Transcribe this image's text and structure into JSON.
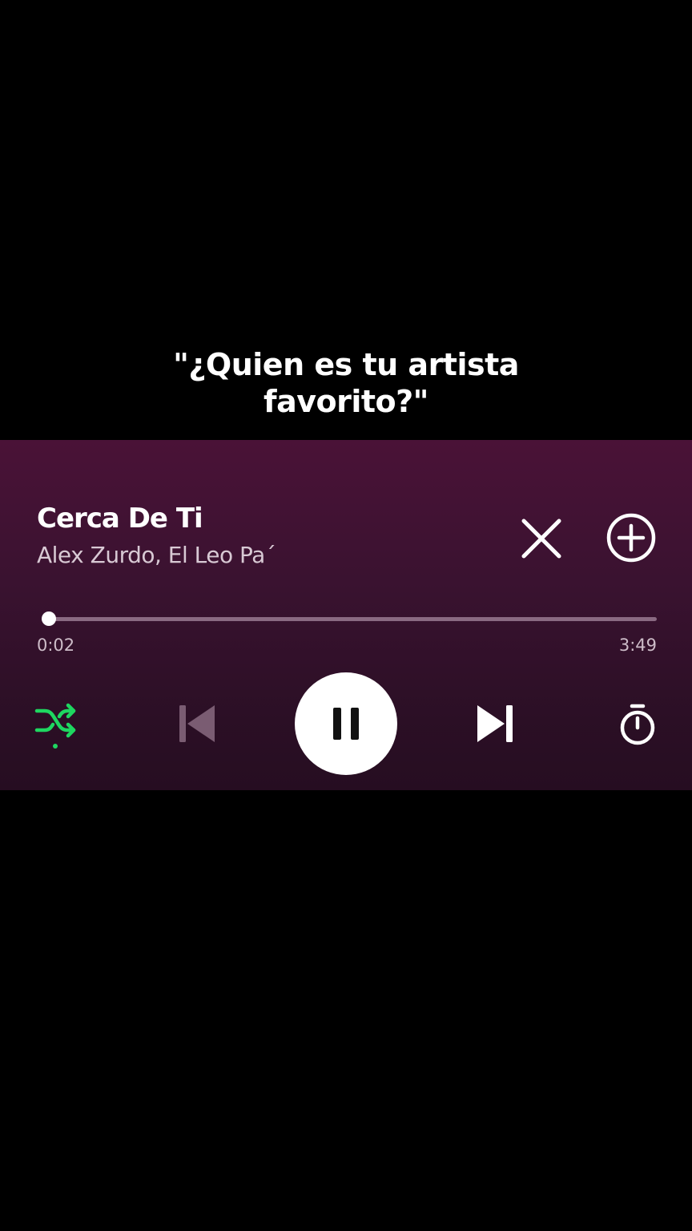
{
  "caption": {
    "line1": "\"¿Quien es tu artista",
    "line2": "favorito?\""
  },
  "player": {
    "track_title": "Cerca De Ti",
    "artist": "Alex Zurdo, El Leo Pa´",
    "elapsed": "0:02",
    "duration": "3:49",
    "progress_fraction": 0.009,
    "shuffle_active": true,
    "is_playing": true,
    "icons": {
      "close": "close-icon",
      "add": "add-circle-icon",
      "shuffle": "shuffle-icon",
      "previous": "skip-previous-icon",
      "pause": "pause-icon",
      "next": "skip-next-icon",
      "timer": "sleep-timer-icon"
    }
  },
  "colors": {
    "accent_green": "#1ed760",
    "player_bg_top": "#4a1237",
    "player_bg_bottom": "#260d21",
    "text_primary": "#ffffff",
    "text_secondary": "#d8c9d4"
  }
}
